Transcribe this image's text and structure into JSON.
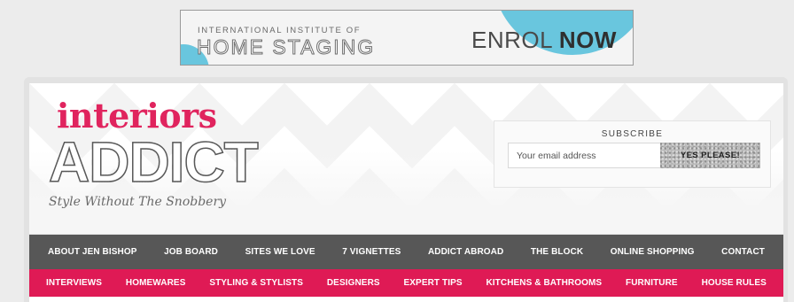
{
  "ad": {
    "line1": "INTERNATIONAL INSTITUTE OF",
    "line2": "HOME STAGING",
    "cta_light": "ENROL",
    "cta_bold": "NOW",
    "accent_color": "#69c6de"
  },
  "logo": {
    "top": "interiors",
    "main": "ADDICT",
    "tagline": "Style Without The Snobbery",
    "brand_color": "#e0245e"
  },
  "subscribe": {
    "title": "SUBSCRIBE",
    "email_placeholder": "Your email address",
    "button_label": "YES PLEASE!"
  },
  "nav_primary": {
    "background": "#575757",
    "items": [
      "ABOUT JEN BISHOP",
      "JOB BOARD",
      "SITES WE LOVE",
      "7 VIGNETTES",
      "ADDICT ABROAD",
      "THE BLOCK",
      "ONLINE SHOPPING",
      "CONTACT"
    ]
  },
  "nav_secondary": {
    "background": "#df1a55",
    "items": [
      "INTERVIEWS",
      "HOMEWARES",
      "STYLING & STYLISTS",
      "DESIGNERS",
      "EXPERT TIPS",
      "KITCHENS & BATHROOMS",
      "FURNITURE",
      "HOUSE RULES"
    ]
  }
}
